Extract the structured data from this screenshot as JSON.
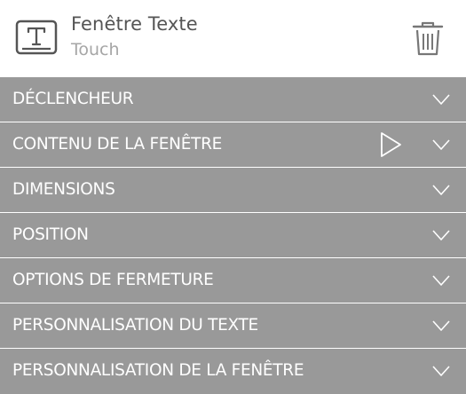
{
  "widget": {
    "title": "Fenêtre Texte",
    "subtitle": "Touch",
    "icon": "text-window-icon",
    "delete_icon": "trash-icon"
  },
  "sections": [
    {
      "label": "DÉCLENCHEUR"
    },
    {
      "label": "CONTENU DE LA FENÊTRE",
      "has_preview": true
    },
    {
      "label": "DIMENSIONS"
    },
    {
      "label": "POSITION"
    },
    {
      "label": "OPTIONS DE FERMETURE"
    },
    {
      "label": "PERSONNALISATION DU TEXTE"
    },
    {
      "label": "PERSONNALISATION DE LA FENÊTRE"
    }
  ],
  "colors": {
    "section_bg": "#999999",
    "section_text": "#ffffff",
    "title_text": "#555555",
    "subtitle_text": "#a6a6a6",
    "icon_stroke": "#555555"
  }
}
